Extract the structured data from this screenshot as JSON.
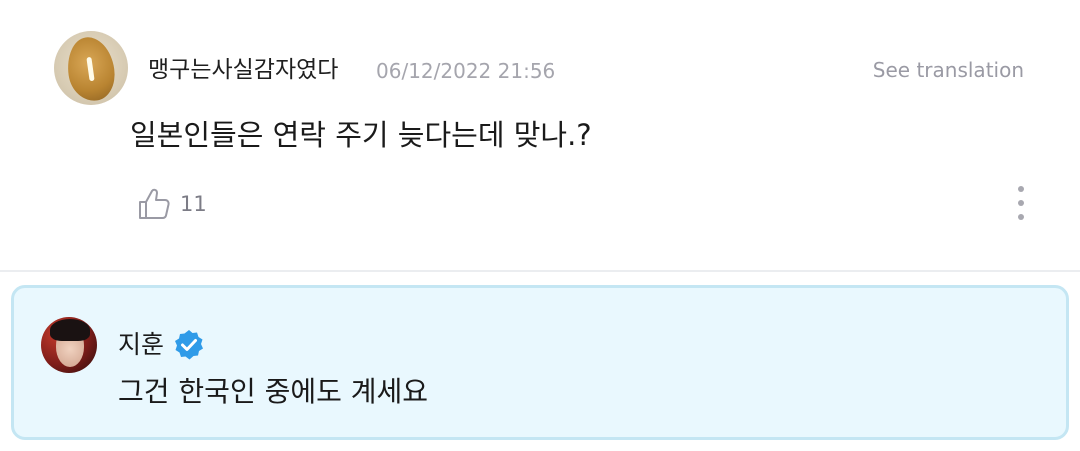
{
  "comment": {
    "author": "맹구는사실감자였다",
    "timestamp": "06/12/2022 21:56",
    "see_translation": "See translation",
    "text": "일본인들은 연락 주기 늦다는데 맞나.?",
    "like_count": "11",
    "avatar_icon": "potato-avatar",
    "like_icon": "thumbs-up-icon",
    "more_icon": "vertical-ellipsis-icon"
  },
  "reply": {
    "author": "지훈",
    "verified": true,
    "verified_icon": "verified-badge-icon",
    "text": "그건 한국인 중에도 계세요",
    "avatar_icon": "artist-avatar"
  },
  "colors": {
    "reply_background": "#e9f8fe",
    "reply_border": "#c4e6f3",
    "verified_blue": "#2f9be8",
    "timestamp_gray": "#a5a5ad",
    "divider": "#ebedf0"
  }
}
